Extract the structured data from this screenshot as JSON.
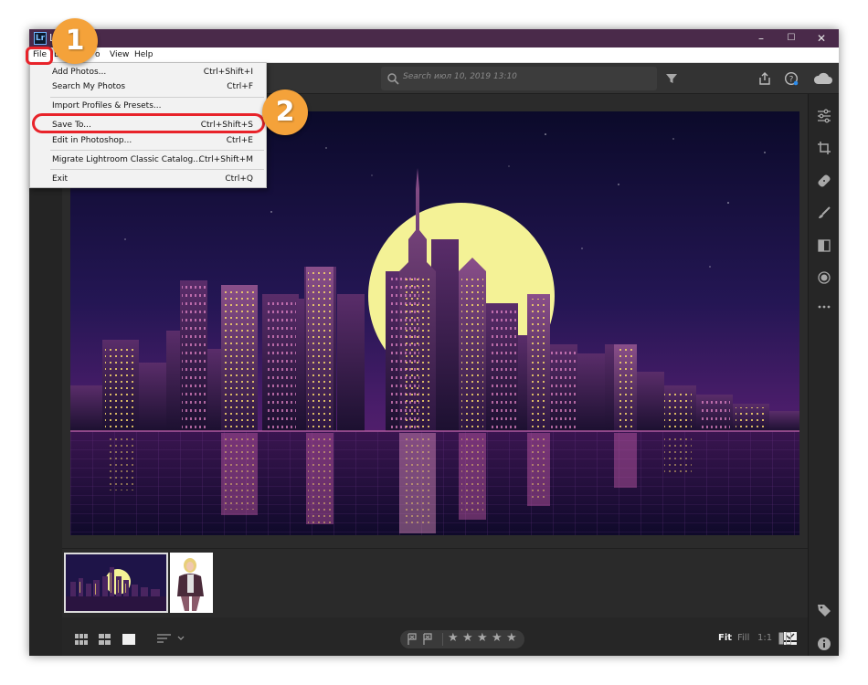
{
  "window": {
    "title": "L",
    "app_icon_text": "Lr",
    "minimize_label": "–",
    "maximize_label": "☐",
    "close_label": "✕"
  },
  "menubar": {
    "items": [
      "File",
      "E",
      "o",
      "View",
      "Help"
    ]
  },
  "toolbar": {
    "search_placeholder": "Search июл 10, 2019 13:10",
    "icons": [
      "share-icon",
      "help-icon",
      "cloud-icon",
      "filter-icon"
    ]
  },
  "file_menu": {
    "items": [
      {
        "label": "Add Photos...",
        "shortcut": "Ctrl+Shift+I"
      },
      {
        "label": "Search My Photos",
        "shortcut": "Ctrl+F"
      },
      {
        "label": "Import Profiles & Presets...",
        "shortcut": ""
      },
      {
        "label": "Save To...",
        "shortcut": "Ctrl+Shift+S"
      },
      {
        "label": "Edit in Photoshop...",
        "shortcut": "Ctrl+E"
      },
      {
        "label": "Migrate Lightroom Classic Catalog...",
        "shortcut": "Ctrl+Shift+M"
      },
      {
        "label": "Exit",
        "shortcut": "Ctrl+Q"
      }
    ]
  },
  "annotations": {
    "step1": "1",
    "step2": "2",
    "color_ring": "#e8232a",
    "color_badge": "#f4a23a"
  },
  "right_panel": {
    "icons": [
      "sliders-icon",
      "crop-icon",
      "healing-icon",
      "brush-icon",
      "gradient-icon",
      "radial-icon",
      "more-icon",
      "tag-icon",
      "info-icon"
    ]
  },
  "bottom_bar": {
    "fit_label": "Fit",
    "fill_label": "Fill",
    "ratio_label": "1:1",
    "stars": [
      "★",
      "★",
      "★",
      "★",
      "★"
    ]
  },
  "colors": {
    "title_bar": "#4a2a4a",
    "workspace": "#2b2b2b",
    "moon": "#f4f296"
  }
}
